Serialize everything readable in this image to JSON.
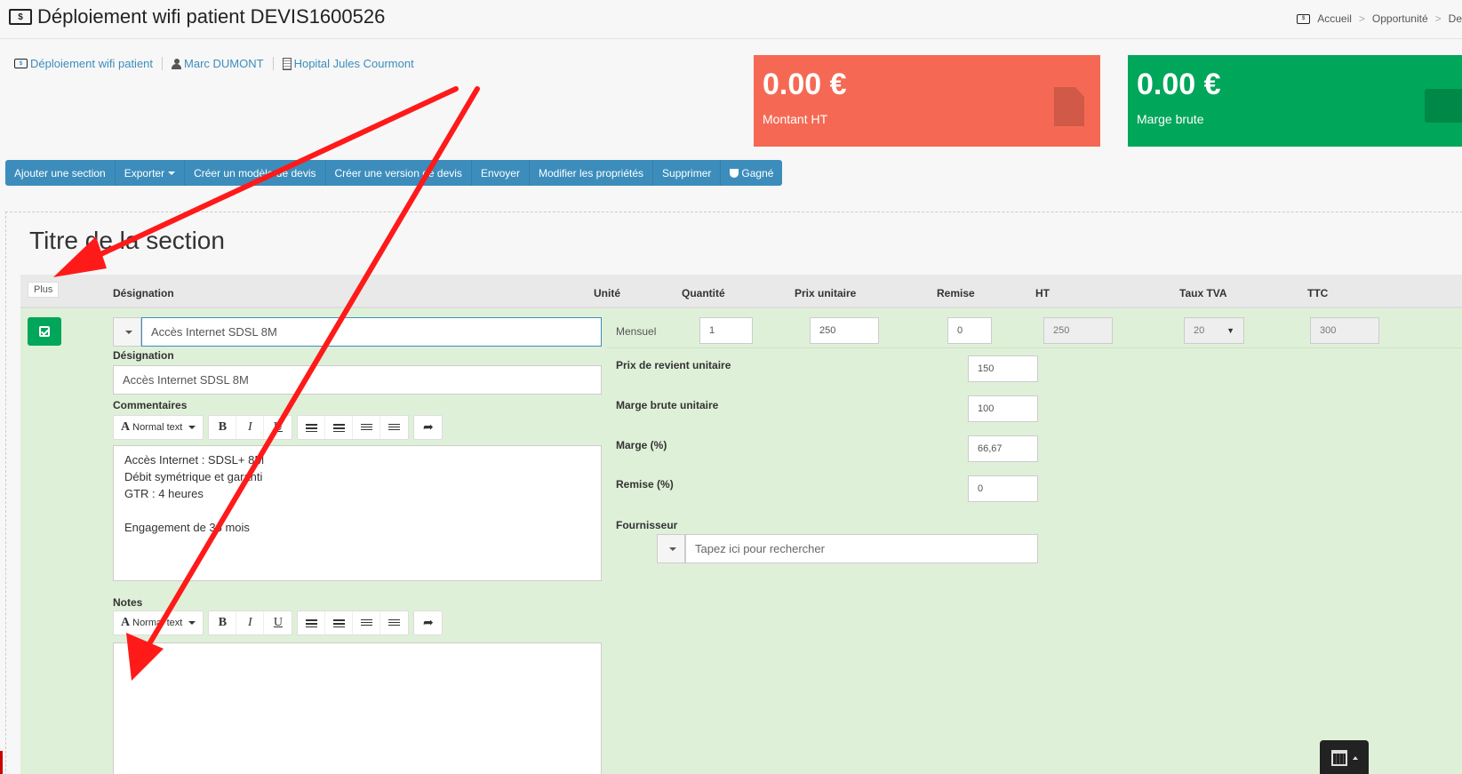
{
  "header": {
    "title": "Déploiement wifi patient DEVIS1600526",
    "breadcrumb": [
      "Accueil",
      "Opportunité",
      "De"
    ]
  },
  "info": {
    "project": "Déploiement wifi patient",
    "contact": "Marc DUMONT",
    "organization": "Hopital Jules Courmont"
  },
  "stats": {
    "amount_value": "0.00 €",
    "amount_label": "Montant HT",
    "margin_value": "0.00 €",
    "margin_label": "Marge brute"
  },
  "toolbar": {
    "add_section": "Ajouter une section",
    "export": "Exporter",
    "create_template": "Créer un modèle de devis",
    "create_version": "Créer une version de devis",
    "send": "Envoyer",
    "edit_properties": "Modifier les propriétés",
    "delete": "Supprimer",
    "won": "Gagné"
  },
  "section": {
    "title": "Titre de la section",
    "plus_label": "Plus",
    "columns": [
      "Désignation",
      "Unité",
      "Quantité",
      "Prix unitaire",
      "Remise",
      "HT",
      "Taux TVA",
      "TTC"
    ]
  },
  "line": {
    "designation_value": "Accès Internet SDSL 8M",
    "unit": "Mensuel",
    "quantity": "1",
    "unit_price": "250",
    "discount": "0",
    "ht": "250",
    "tva": "20",
    "ttc": "300"
  },
  "details": {
    "designation_label": "Désignation",
    "designation_value": "Accès Internet SDSL 8M",
    "comments_label": "Commentaires",
    "comment_lines": [
      "Accès Internet : SDSL+ 8M",
      "Débit symétrique et garanti",
      "GTR : 4 heures",
      "",
      "Engagement de 36 mois"
    ],
    "notes_label": "Notes",
    "editor_style": "Normal text",
    "cost_price_label": "Prix de revient unitaire",
    "cost_price": "150",
    "gross_margin_label": "Marge brute unitaire",
    "gross_margin": "100",
    "margin_pct_label": "Marge (%)",
    "margin_pct": "66,67",
    "discount_pct_label": "Remise (%)",
    "discount_pct": "0",
    "supplier_label": "Fournisseur",
    "supplier_placeholder": "Tapez ici pour rechercher"
  },
  "colors": {
    "accent": "#3c8dbc",
    "red_box": "#f56954",
    "green_box": "#00a65a",
    "row_bg": "#dff0d8",
    "annotation_arrow": "#ff1a1a"
  }
}
